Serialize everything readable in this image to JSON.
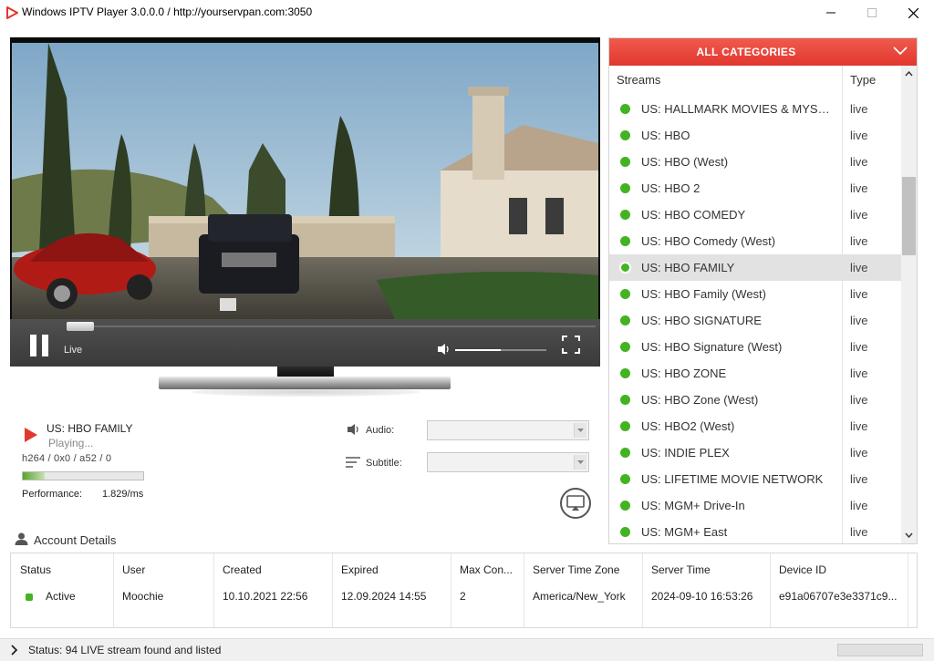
{
  "window": {
    "title": "Windows IPTV Player 3.0.0.0 / http://yourservpan.com:3050",
    "accent": "#e2372d"
  },
  "player": {
    "live_label": "Live",
    "seek_fraction": 0.0,
    "volume_fraction": 0.5
  },
  "now_playing": {
    "channel": "US: HBO FAMILY",
    "status": "Playing...",
    "codec": "h264 / 0x0 / a52  / 0",
    "performance_label": "Performance:",
    "performance_value": "1.829/ms",
    "performance_fraction": 0.18
  },
  "options": {
    "audio_label": "Audio:",
    "subtitle_label": "Subtitle:",
    "audio_value": "",
    "subtitle_value": ""
  },
  "channels": {
    "category": "ALL CATEGORIES",
    "col_streams": "Streams",
    "col_type": "Type",
    "selected_index": 6,
    "items": [
      {
        "name": "US: HALLMARK MOVIES & MYSTERIES",
        "type": "live"
      },
      {
        "name": "US: HBO",
        "type": "live"
      },
      {
        "name": "US: HBO (West)",
        "type": "live"
      },
      {
        "name": "US: HBO 2",
        "type": "live"
      },
      {
        "name": "US: HBO COMEDY",
        "type": "live"
      },
      {
        "name": "US: HBO Comedy (West)",
        "type": "live"
      },
      {
        "name": "US: HBO FAMILY",
        "type": "live"
      },
      {
        "name": "US: HBO Family (West)",
        "type": "live"
      },
      {
        "name": "US: HBO SIGNATURE",
        "type": "live"
      },
      {
        "name": "US: HBO Signature (West)",
        "type": "live"
      },
      {
        "name": "US: HBO ZONE",
        "type": "live"
      },
      {
        "name": "US: HBO Zone (West)",
        "type": "live"
      },
      {
        "name": "US: HBO2 (West)",
        "type": "live"
      },
      {
        "name": "US: INDIE PLEX",
        "type": "live"
      },
      {
        "name": "US: LIFETIME MOVIE NETWORK",
        "type": "live"
      },
      {
        "name": "US: MGM+ Drive-In",
        "type": "live"
      },
      {
        "name": "US: MGM+ East",
        "type": "live"
      }
    ]
  },
  "account": {
    "title": "Account Details",
    "headers": {
      "status": "Status",
      "user": "User",
      "created": "Created",
      "expired": "Expired",
      "max_connections": "Max Con...",
      "server_time_zone": "Server Time Zone",
      "server_time": "Server Time",
      "device_id": "Device ID"
    },
    "values": {
      "status": "Active",
      "user": "Moochie",
      "created": "10.10.2021 22:56",
      "expired": "12.09.2024 14:55",
      "max_connections": "2",
      "server_time_zone": "America/New_York",
      "server_time": "2024-09-10 16:53:26",
      "device_id": "e91a06707e3e3371c9..."
    }
  },
  "status_bar": {
    "text": "Status: 94 LIVE stream found and listed"
  }
}
